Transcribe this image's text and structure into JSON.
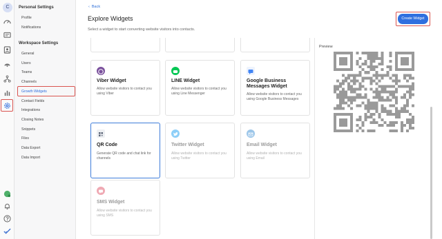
{
  "rail": {
    "avatar_letter": "C",
    "icons": [
      "dashboard-icon",
      "chat-icon",
      "contacts-icon",
      "broadcast-icon",
      "workflow-icon",
      "reports-icon",
      "settings-icon",
      "status-icon",
      "notifications-icon",
      "help-icon",
      "checkmark-icon"
    ]
  },
  "sidebar": {
    "personal_title": "Personal Settings",
    "personal_items": [
      "Profile",
      "Notifications"
    ],
    "workspace_title": "Workspace Settings",
    "workspace_items": [
      "General",
      "Users",
      "Teams",
      "Channels",
      "Growth Widgets",
      "Contact Fields",
      "Integrations",
      "Closing Notes",
      "Snippets",
      "Files",
      "Data Export",
      "Data Import"
    ],
    "active_item": "Growth Widgets"
  },
  "header": {
    "back_label": "Back",
    "title": "Explore Widgets",
    "subtitle": "Select a widget to start converting website visitors into contacts.",
    "create_button": "Create Widget"
  },
  "widgets": [
    {
      "name": "Viber Widget",
      "desc": "Allow website visitors to contact you using Viber",
      "icon": "viber-icon",
      "color": "#7b519d",
      "state": "normal"
    },
    {
      "name": "LINE Widget",
      "desc": "Allow website visitors to contact you using Line Messenger",
      "icon": "line-icon",
      "color": "#06c755",
      "state": "normal"
    },
    {
      "name": "Google Business Messages Widget",
      "desc": "Allow website visitors to contact you using Google Business Messages",
      "icon": "google-business-messages-icon",
      "color": "#4285f4",
      "state": "normal"
    },
    {
      "name": "QR Code",
      "desc": "Generate QR code and chat link for channels",
      "icon": "qr-code-icon",
      "color": "#5b6577",
      "state": "selected"
    },
    {
      "name": "Twitter Widget",
      "desc": "Allow website visitors to contact you using Twitter",
      "icon": "twitter-icon",
      "color": "#1da1f2",
      "state": "disabled"
    },
    {
      "name": "Email Widget",
      "desc": "Allow website visitors to contact you using Email",
      "icon": "email-icon",
      "color": "#3b8ed4",
      "state": "disabled"
    },
    {
      "name": "SMS Widget",
      "desc": "Allow website visitors to contact you using SMS",
      "icon": "sms-icon",
      "color": "#e0556a",
      "state": "disabled"
    }
  ],
  "preview": {
    "label": "Preview"
  },
  "colors": {
    "accent": "#2f6fdf",
    "highlight": "#d9534f"
  }
}
